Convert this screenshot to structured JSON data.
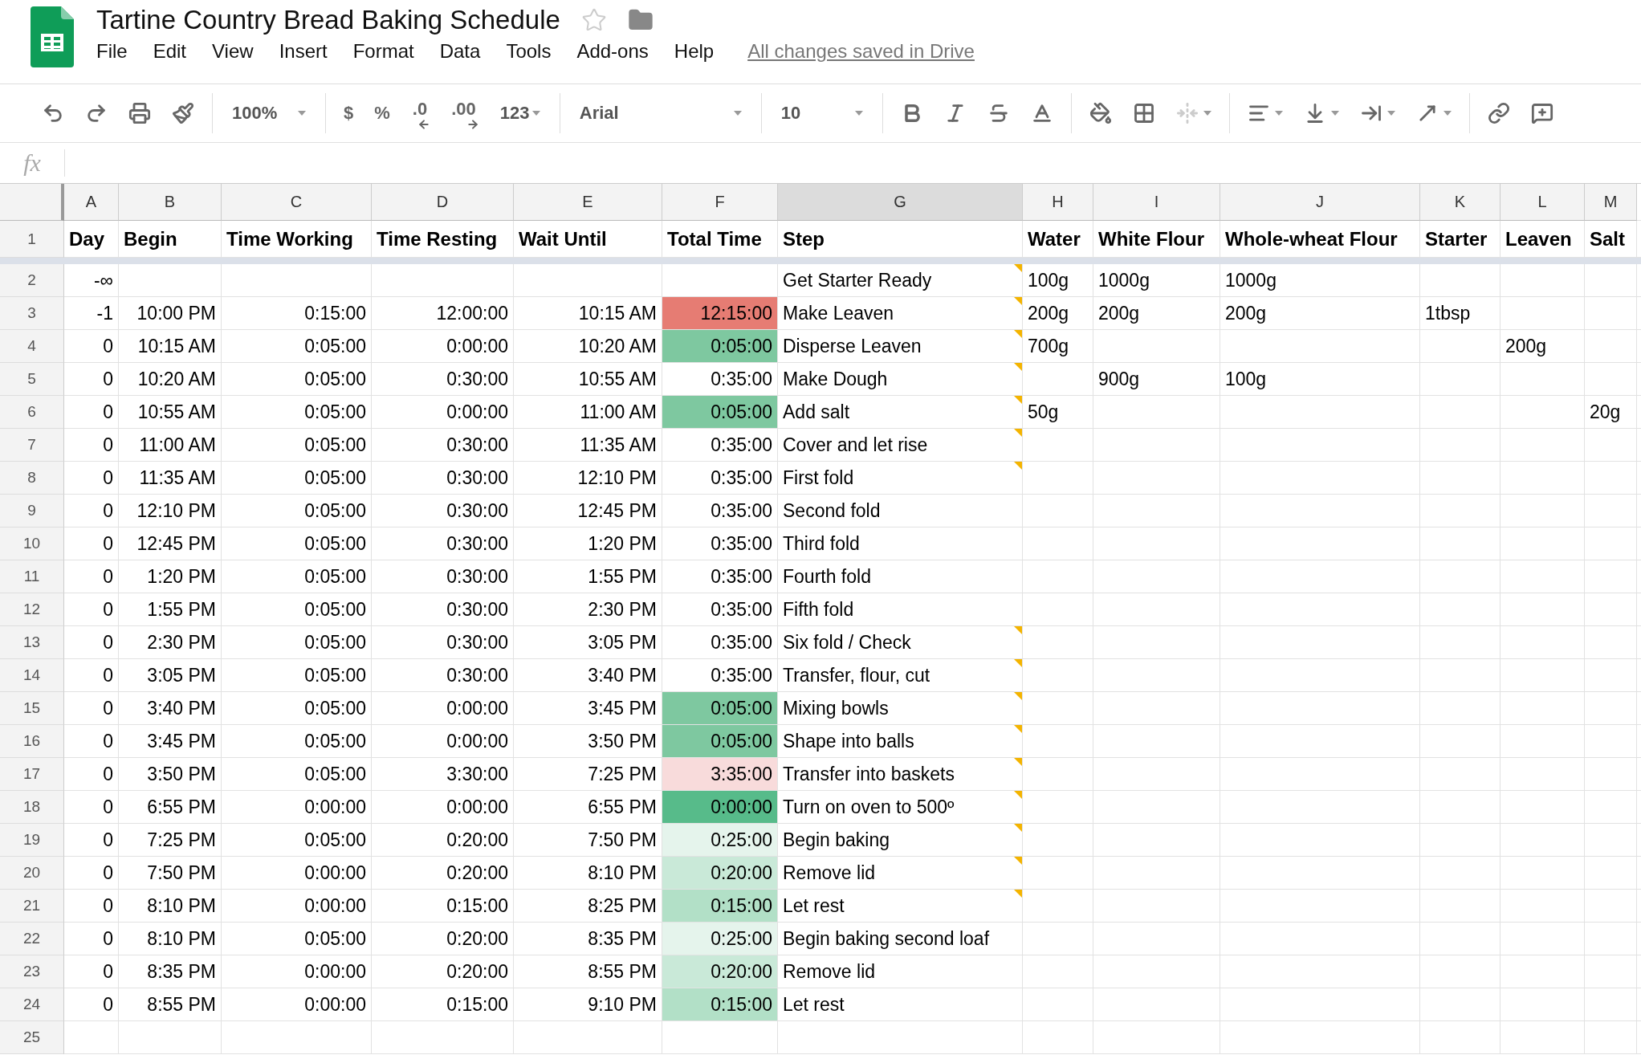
{
  "doc": {
    "title": "Tartine Country Bread Baking Schedule",
    "menus": [
      "File",
      "Edit",
      "View",
      "Insert",
      "Format",
      "Data",
      "Tools",
      "Add-ons",
      "Help"
    ],
    "save_status": "All changes saved in Drive"
  },
  "toolbar": {
    "zoom": "100%",
    "currency": "$",
    "percent": "%",
    "decrease_decimals": ".0",
    "increase_decimals": ".00",
    "more_formats": "123",
    "font": "Arial",
    "font_size": "10"
  },
  "formula_bar": {
    "label": "fx"
  },
  "sheet": {
    "columns": [
      {
        "letter": "A",
        "selected": false
      },
      {
        "letter": "B",
        "selected": false
      },
      {
        "letter": "C",
        "selected": false
      },
      {
        "letter": "D",
        "selected": false
      },
      {
        "letter": "E",
        "selected": false
      },
      {
        "letter": "F",
        "selected": false
      },
      {
        "letter": "G",
        "selected": true
      },
      {
        "letter": "H",
        "selected": false
      },
      {
        "letter": "I",
        "selected": false
      },
      {
        "letter": "J",
        "selected": false
      },
      {
        "letter": "K",
        "selected": false
      },
      {
        "letter": "L",
        "selected": false
      },
      {
        "letter": "M",
        "selected": false
      }
    ],
    "header_row": {
      "number": "1",
      "cells": {
        "A": "Day",
        "B": "Begin",
        "C": "Time Working",
        "D": "Time Resting",
        "E": "Wait Until",
        "F": "Total Time",
        "G": "Step",
        "H": "Water",
        "I": "White Flour",
        "J": "Whole-wheat Flour",
        "K": "Starter",
        "L": "Leaven",
        "M": "Salt"
      }
    },
    "rows": [
      {
        "number": "2",
        "note": true,
        "cells": {
          "A": "-∞",
          "G": "Get Starter Ready",
          "H": "100g",
          "I": "1000g",
          "J": "1000g"
        }
      },
      {
        "number": "3",
        "note": true,
        "color": "#e67c73",
        "cells": {
          "A": "-1",
          "B": "10:00 PM",
          "C": "0:15:00",
          "D": "12:00:00",
          "E": "10:15 AM",
          "F": "12:15:00",
          "G": "Make Leaven",
          "H": "200g",
          "I": "200g",
          "J": "200g",
          "K": "1tbsp"
        }
      },
      {
        "number": "4",
        "note": true,
        "color": "#7ec8a0",
        "cells": {
          "A": "0",
          "B": "10:15 AM",
          "C": "0:05:00",
          "D": "0:00:00",
          "E": "10:20 AM",
          "F": "0:05:00",
          "G": "Disperse Leaven",
          "H": "700g",
          "L": "200g"
        }
      },
      {
        "number": "5",
        "note": true,
        "cells": {
          "A": "0",
          "B": "10:20 AM",
          "C": "0:05:00",
          "D": "0:30:00",
          "E": "10:55 AM",
          "F": "0:35:00",
          "G": "Make Dough",
          "I": "900g",
          "J": "100g"
        }
      },
      {
        "number": "6",
        "note": true,
        "color": "#7ec8a0",
        "cells": {
          "A": "0",
          "B": "10:55 AM",
          "C": "0:05:00",
          "D": "0:00:00",
          "E": "11:00 AM",
          "F": "0:05:00",
          "G": "Add salt",
          "H": "50g",
          "M": "20g"
        }
      },
      {
        "number": "7",
        "note": true,
        "cells": {
          "A": "0",
          "B": "11:00 AM",
          "C": "0:05:00",
          "D": "0:30:00",
          "E": "11:35 AM",
          "F": "0:35:00",
          "G": "Cover and let rise"
        }
      },
      {
        "number": "8",
        "note": true,
        "cells": {
          "A": "0",
          "B": "11:35 AM",
          "C": "0:05:00",
          "D": "0:30:00",
          "E": "12:10 PM",
          "F": "0:35:00",
          "G": "First fold"
        }
      },
      {
        "number": "9",
        "note": false,
        "cells": {
          "A": "0",
          "B": "12:10 PM",
          "C": "0:05:00",
          "D": "0:30:00",
          "E": "12:45 PM",
          "F": "0:35:00",
          "G": "Second fold"
        }
      },
      {
        "number": "10",
        "note": false,
        "cells": {
          "A": "0",
          "B": "12:45 PM",
          "C": "0:05:00",
          "D": "0:30:00",
          "E": "1:20 PM",
          "F": "0:35:00",
          "G": "Third fold"
        }
      },
      {
        "number": "11",
        "note": false,
        "cells": {
          "A": "0",
          "B": "1:20 PM",
          "C": "0:05:00",
          "D": "0:30:00",
          "E": "1:55 PM",
          "F": "0:35:00",
          "G": "Fourth fold"
        }
      },
      {
        "number": "12",
        "note": false,
        "cells": {
          "A": "0",
          "B": "1:55 PM",
          "C": "0:05:00",
          "D": "0:30:00",
          "E": "2:30 PM",
          "F": "0:35:00",
          "G": "Fifth fold"
        }
      },
      {
        "number": "13",
        "note": true,
        "cells": {
          "A": "0",
          "B": "2:30 PM",
          "C": "0:05:00",
          "D": "0:30:00",
          "E": "3:05 PM",
          "F": "0:35:00",
          "G": "Six fold / Check"
        }
      },
      {
        "number": "14",
        "note": true,
        "cells": {
          "A": "0",
          "B": "3:05 PM",
          "C": "0:05:00",
          "D": "0:30:00",
          "E": "3:40 PM",
          "F": "0:35:00",
          "G": "Transfer, flour, cut"
        }
      },
      {
        "number": "15",
        "note": true,
        "color": "#7ec8a0",
        "cells": {
          "A": "0",
          "B": "3:40 PM",
          "C": "0:05:00",
          "D": "0:00:00",
          "E": "3:45 PM",
          "F": "0:05:00",
          "G": "Mixing bowls"
        }
      },
      {
        "number": "16",
        "note": true,
        "color": "#7ec8a0",
        "cells": {
          "A": "0",
          "B": "3:45 PM",
          "C": "0:05:00",
          "D": "0:00:00",
          "E": "3:50 PM",
          "F": "0:05:00",
          "G": "Shape into balls"
        }
      },
      {
        "number": "17",
        "note": true,
        "color": "#f8dbdb",
        "cells": {
          "A": "0",
          "B": "3:50 PM",
          "C": "0:05:00",
          "D": "3:30:00",
          "E": "7:25 PM",
          "F": "3:35:00",
          "G": "Transfer into baskets"
        }
      },
      {
        "number": "18",
        "note": true,
        "color": "#57bb8a",
        "cells": {
          "A": "0",
          "B": "6:55 PM",
          "C": "0:00:00",
          "D": "0:00:00",
          "E": "6:55 PM",
          "F": "0:00:00",
          "G": "Turn on oven to 500º"
        }
      },
      {
        "number": "19",
        "note": true,
        "color": "#e5f4ec",
        "cells": {
          "A": "0",
          "B": "7:25 PM",
          "C": "0:05:00",
          "D": "0:20:00",
          "E": "7:50 PM",
          "F": "0:25:00",
          "G": "Begin baking"
        }
      },
      {
        "number": "20",
        "note": true,
        "color": "#c9e9d8",
        "cells": {
          "A": "0",
          "B": "7:50 PM",
          "C": "0:00:00",
          "D": "0:20:00",
          "E": "8:10 PM",
          "F": "0:20:00",
          "G": "Remove lid"
        }
      },
      {
        "number": "21",
        "note": true,
        "color": "#b2e0c7",
        "cells": {
          "A": "0",
          "B": "8:10 PM",
          "C": "0:00:00",
          "D": "0:15:00",
          "E": "8:25 PM",
          "F": "0:15:00",
          "G": "Let rest"
        }
      },
      {
        "number": "22",
        "note": false,
        "color": "#e5f4ec",
        "cells": {
          "A": "0",
          "B": "8:10 PM",
          "C": "0:05:00",
          "D": "0:20:00",
          "E": "8:35 PM",
          "F": "0:25:00",
          "G": "Begin baking second loaf"
        }
      },
      {
        "number": "23",
        "note": false,
        "color": "#c9e9d8",
        "cells": {
          "A": "0",
          "B": "8:35 PM",
          "C": "0:00:00",
          "D": "0:20:00",
          "E": "8:55 PM",
          "F": "0:20:00",
          "G": "Remove lid"
        }
      },
      {
        "number": "24",
        "note": false,
        "color": "#b2e0c7",
        "cells": {
          "A": "0",
          "B": "8:55 PM",
          "C": "0:00:00",
          "D": "0:15:00",
          "E": "9:10 PM",
          "F": "0:15:00",
          "G": "Let rest"
        }
      },
      {
        "number": "25",
        "note": false,
        "cells": {}
      }
    ]
  }
}
